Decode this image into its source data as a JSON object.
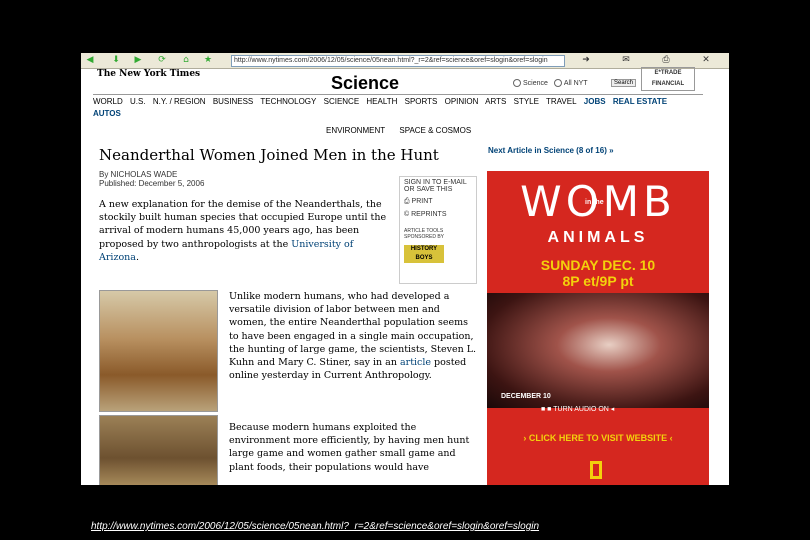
{
  "browser": {
    "url": "http://www.nytimes.com/2006/12/05/science/05nean.html?_r=2&ref=science&oref=slogin&oref=slogin"
  },
  "site": {
    "logo": "The New York Times",
    "section": "Science",
    "search_option_science": "Science",
    "search_option_all": "All NYT",
    "search_button": "Search",
    "ad_small": "E*TRADE FINANCIAL"
  },
  "nav": {
    "items": [
      "WORLD",
      "U.S.",
      "N.Y. / REGION",
      "BUSINESS",
      "TECHNOLOGY",
      "SCIENCE",
      "HEALTH",
      "SPORTS",
      "OPINION",
      "ARTS",
      "STYLE",
      "TRAVEL",
      "JOBS",
      "REAL ESTATE"
    ],
    "autos": "AUTOS",
    "sub": [
      "ENVIRONMENT",
      "SPACE & COSMOS"
    ]
  },
  "article": {
    "headline": "Neanderthal Women Joined Men in the Hunt",
    "byline": "By NICHOLAS WADE",
    "published": "Published: December 5, 2006",
    "lede": "A new explanation for the demise of the Neanderthals, the stockily built human species that occupied Europe until the arrival of modern humans 45,000 years ago, has been proposed by two anthropologists at the ",
    "lede_link": "University of Arizona",
    "lede_end": ".",
    "para2_a": "Unlike modern humans, who had developed a versatile division of labor between men and women, the entire Neanderthal population seems to have been engaged in a single main occupation, the hunting of large game, the scientists, Steven L. Kuhn and Mary C. Stiner, say in an ",
    "para2_link": "article",
    "para2_b": " posted online yesterday in Current Anthropology.",
    "para3": "Because modern humans exploited the environment more efficiently, by having men hunt large game and women gather small game and plant foods, their populations would have"
  },
  "tools": {
    "signin": "SIGN IN TO E-MAIL OR SAVE THIS",
    "print": "PRINT",
    "reprints": "REPRINTS",
    "sponsored": "ARTICLE TOOLS SPONSORED BY",
    "sponsor": "HISTORY BOYS"
  },
  "sidebar": {
    "next": "Next Article in Science (8 of 16) »"
  },
  "ad": {
    "big": "WOMB",
    "in_the": "in the",
    "animals": "ANIMALS",
    "date_line1": "SUNDAY DEC. 10",
    "date_line2": "8P et/9P pt",
    "photo_date": "DECEMBER 10",
    "audio": "TURN AUDIO ON",
    "cta": "› CLICK HERE TO VISIT WEBSITE ‹"
  },
  "caption": "http://www.nytimes.com/2006/12/05/science/05nean.html?_r=2&ref=science&oref=slogin&oref=slogin"
}
